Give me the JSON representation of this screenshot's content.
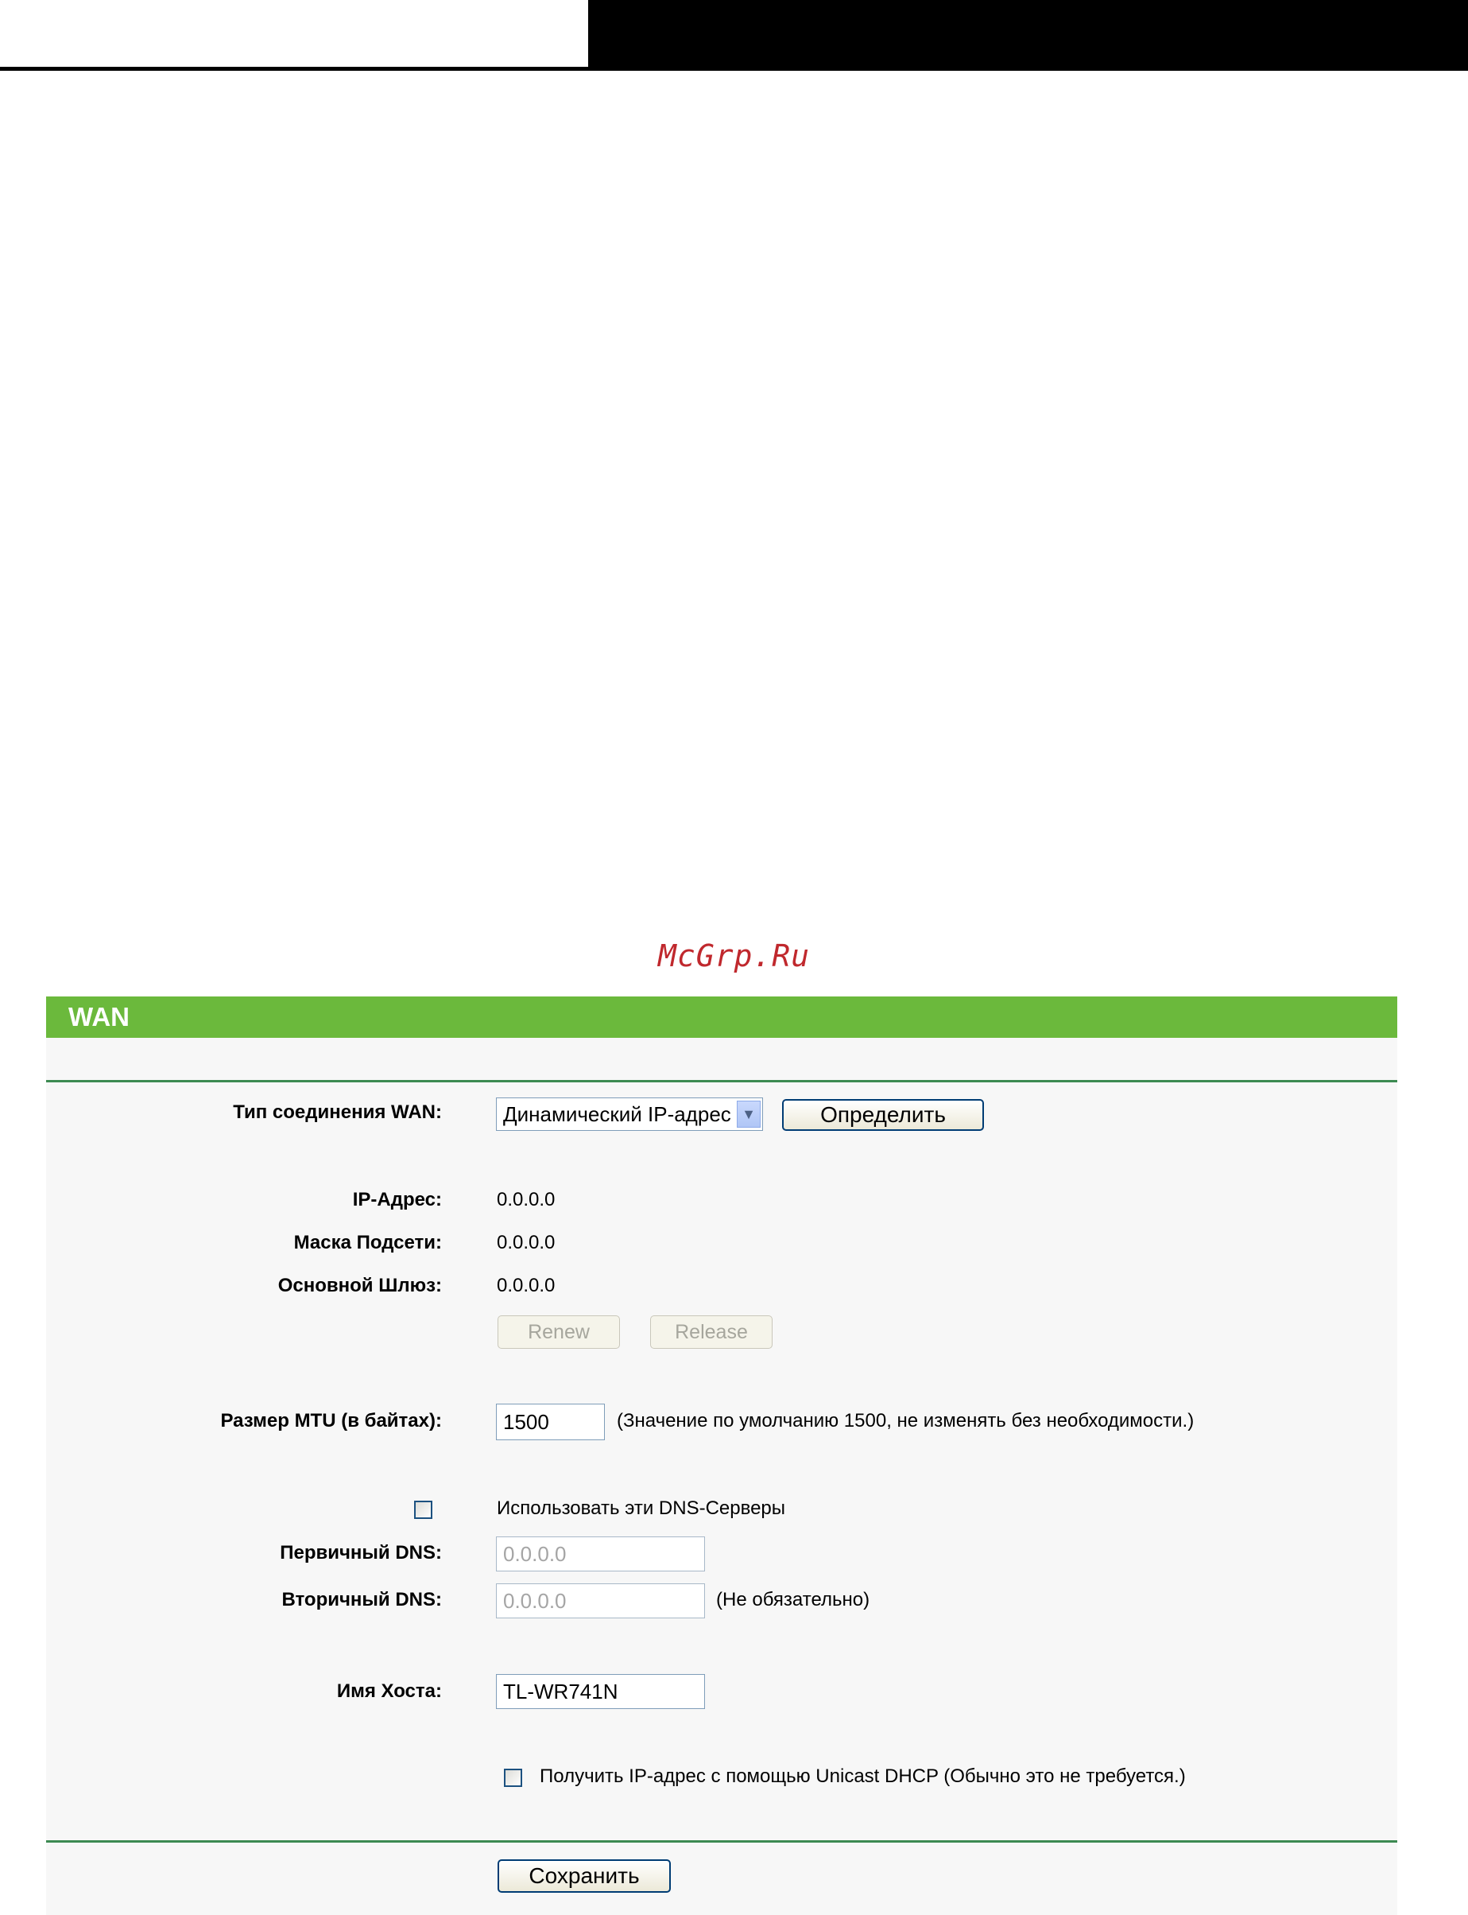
{
  "watermark": "McGrp.Ru",
  "panel": {
    "title": "WAN",
    "connection_type": {
      "label": "Тип соединения WAN:",
      "selected": "Динамический IP-адрес",
      "detect_button": "Определить"
    },
    "ip_address": {
      "label": "IP-Адрес:",
      "value": "0.0.0.0"
    },
    "subnet_mask": {
      "label": "Маска Подсети:",
      "value": "0.0.0.0"
    },
    "gateway": {
      "label": "Основной Шлюз:",
      "value": "0.0.0.0"
    },
    "renew_button": "Renew",
    "release_button": "Release",
    "mtu": {
      "label": "Размер MTU (в байтах):",
      "value": "1500",
      "hint": "(Значение по умолчанию 1500, не изменять без необходимости.)"
    },
    "use_dns": {
      "label": "Использовать эти DNS-Серверы",
      "checked": false
    },
    "primary_dns": {
      "label": "Первичный DNS:",
      "value": "0.0.0.0"
    },
    "secondary_dns": {
      "label": "Вторичный DNS:",
      "value": "0.0.0.0",
      "hint": "(Не обязательно)"
    },
    "hostname": {
      "label": "Имя Хоста:",
      "value": "TL-WR741N"
    },
    "unicast_dhcp": {
      "label": "Получить IP-адрес с помощью Unicast DHCP (Обычно это не требуется.)",
      "checked": false
    },
    "save_button": "Сохранить"
  }
}
